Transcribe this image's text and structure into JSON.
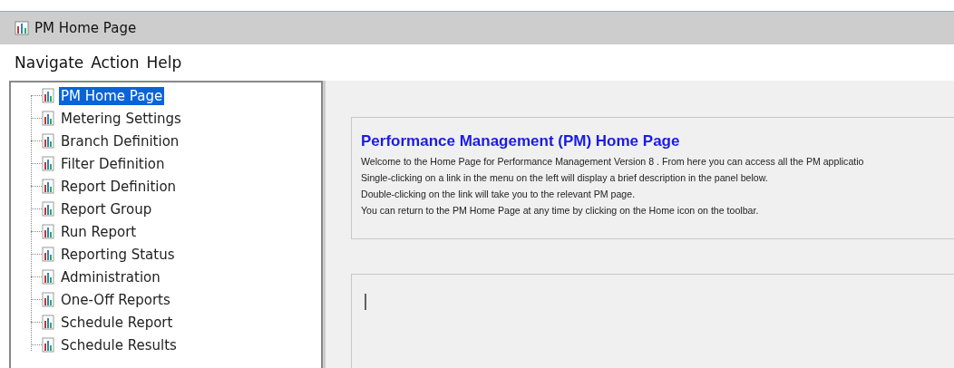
{
  "window": {
    "title": "PM Home Page"
  },
  "menu": [
    "Navigate",
    "Action",
    "Help"
  ],
  "tree": {
    "items": [
      {
        "label": "PM Home Page",
        "selected": true
      },
      {
        "label": "Metering Settings",
        "selected": false
      },
      {
        "label": "Branch Definition",
        "selected": false
      },
      {
        "label": "Filter Definition",
        "selected": false
      },
      {
        "label": "Report Definition",
        "selected": false
      },
      {
        "label": "Report Group",
        "selected": false
      },
      {
        "label": "Run Report",
        "selected": false
      },
      {
        "label": "Reporting Status",
        "selected": false
      },
      {
        "label": "Administration",
        "selected": false
      },
      {
        "label": "One-Off Reports",
        "selected": false
      },
      {
        "label": "Schedule Report",
        "selected": false
      },
      {
        "label": "Schedule Results",
        "selected": false
      }
    ]
  },
  "welcome": {
    "heading": "Performance Management (PM) Home Page",
    "lines": [
      "Welcome to the Home Page for Performance Management Version 8 . From here you can access all the PM applicatio",
      "Single-clicking on a link in the menu on the left will display a brief description in the panel below.",
      "Double-clicking on the link will take you to the relevant PM page.",
      "You can return to the PM Home Page at any time by clicking on the Home icon on the toolbar."
    ]
  },
  "description": {
    "value": "|"
  }
}
